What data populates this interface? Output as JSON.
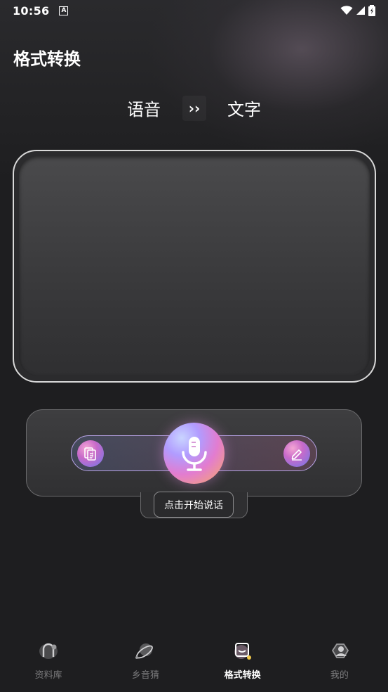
{
  "status_bar": {
    "time": "10:56",
    "notification_badge": "A"
  },
  "page": {
    "title": "格式转换"
  },
  "conversion": {
    "source_label": "语音",
    "swap_symbol": "››",
    "target_label": "文字"
  },
  "controls": {
    "hint": "点击开始说话"
  },
  "bottom_nav": {
    "items": [
      {
        "label": "资料库",
        "icon": "library-icon",
        "active": false
      },
      {
        "label": "乡音猜",
        "icon": "planet-icon",
        "active": false
      },
      {
        "label": "格式转换",
        "icon": "convert-icon",
        "active": true
      },
      {
        "label": "我的",
        "icon": "profile-icon",
        "active": false
      }
    ]
  },
  "colors": {
    "background": "#1e1e20",
    "accent_pink": "#e27cd0",
    "accent_violet": "#b19cff",
    "nav_inactive": "#7a7a7c"
  }
}
